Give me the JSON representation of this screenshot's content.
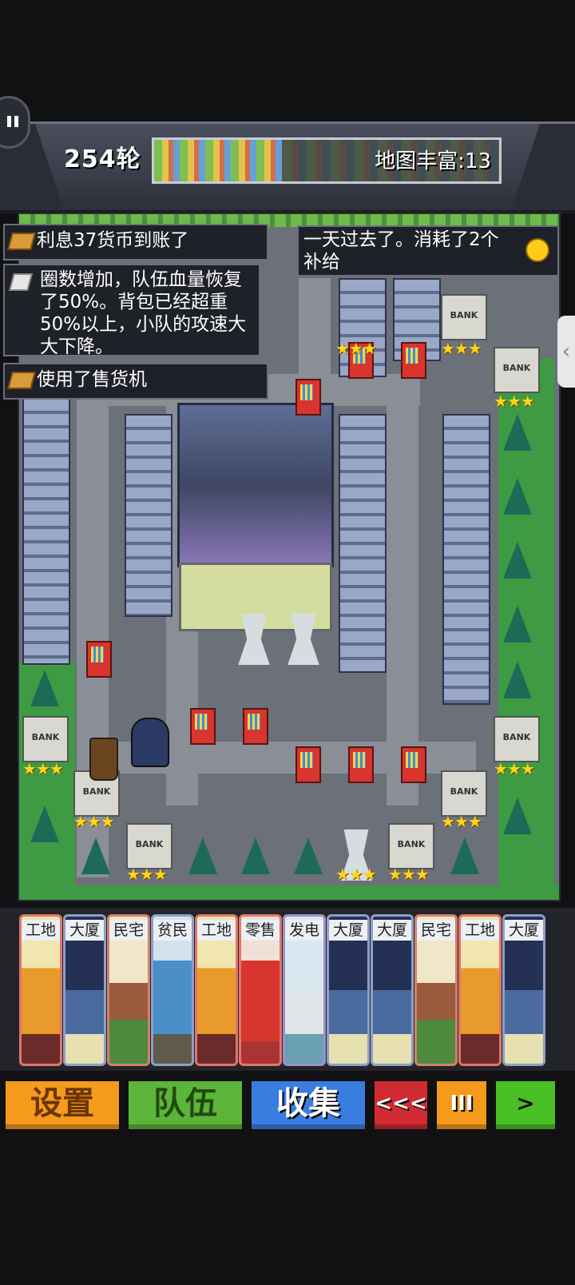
{
  "hud": {
    "round": "254轮",
    "richness_label": "地图丰富:13",
    "richness_fill": 0.37
  },
  "log": {
    "top_left": "利息37货币到账了",
    "top_right": "一天过去了。消耗了2个补给",
    "main": "圈数增加，队伍血量恢复了50%。背包已经超重50%以上，小队的攻速大大下降。",
    "vending": "使用了售货机"
  },
  "map": {
    "bank_label": "BANK",
    "stars": "★★★"
  },
  "cards": [
    {
      "label": "工地",
      "type": "factory"
    },
    {
      "label": "大厦",
      "type": "tower-c"
    },
    {
      "label": "民宅",
      "type": "home"
    },
    {
      "label": "贫民",
      "type": "poor"
    },
    {
      "label": "工地",
      "type": "factory"
    },
    {
      "label": "零售",
      "type": "vendc"
    },
    {
      "label": "发电",
      "type": "power"
    },
    {
      "label": "大厦",
      "type": "tower-c"
    },
    {
      "label": "大厦",
      "type": "tower-c"
    },
    {
      "label": "民宅",
      "type": "home"
    },
    {
      "label": "工地",
      "type": "factory"
    },
    {
      "label": "大厦",
      "type": "tower-c"
    }
  ],
  "buttons": {
    "settings": "设置",
    "team": "队伍",
    "collect": "收集",
    "rewind": "<<<",
    "pause": "III",
    "forward": ">"
  },
  "side_tab": "‹"
}
